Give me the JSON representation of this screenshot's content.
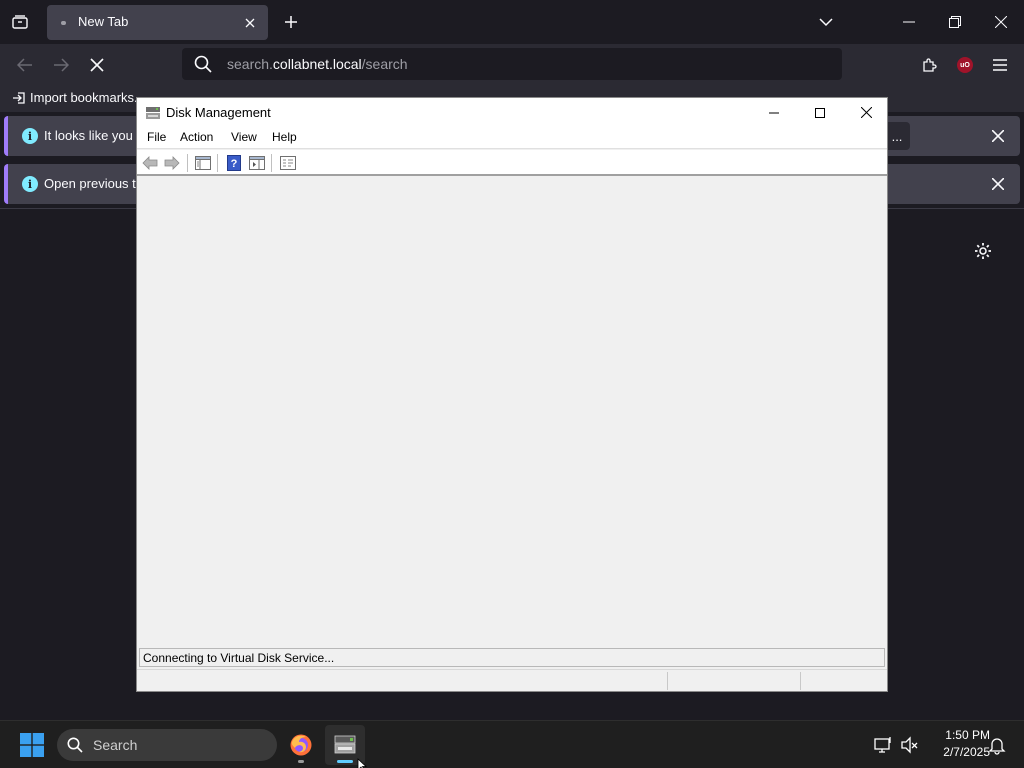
{
  "browser": {
    "tab": {
      "title": "New Tab"
    },
    "url": {
      "pre": "search.",
      "host": "collabnet.local",
      "post": "/search"
    },
    "bookmarks": {
      "import_label": "Import bookmarks..."
    },
    "notifications": [
      {
        "text": "It looks like you ha",
        "button": "..."
      },
      {
        "text": "Open previous tab"
      }
    ]
  },
  "disk_management": {
    "title": "Disk Management",
    "menu": [
      "File",
      "Action",
      "View",
      "Help"
    ],
    "status": "Connecting to Virtual Disk Service..."
  },
  "taskbar": {
    "search_placeholder": "Search",
    "clock": {
      "time": "1:50 PM",
      "date": "2/7/2025"
    }
  },
  "colors": {
    "browser_bg": "#1c1b22",
    "toolbar_bg": "#2b2a33",
    "notification_accent": "#a07cfa",
    "window_bg": "#f0f0f0",
    "taskbar_bg": "#1f1f1f",
    "active_indicator": "#60cdff"
  }
}
